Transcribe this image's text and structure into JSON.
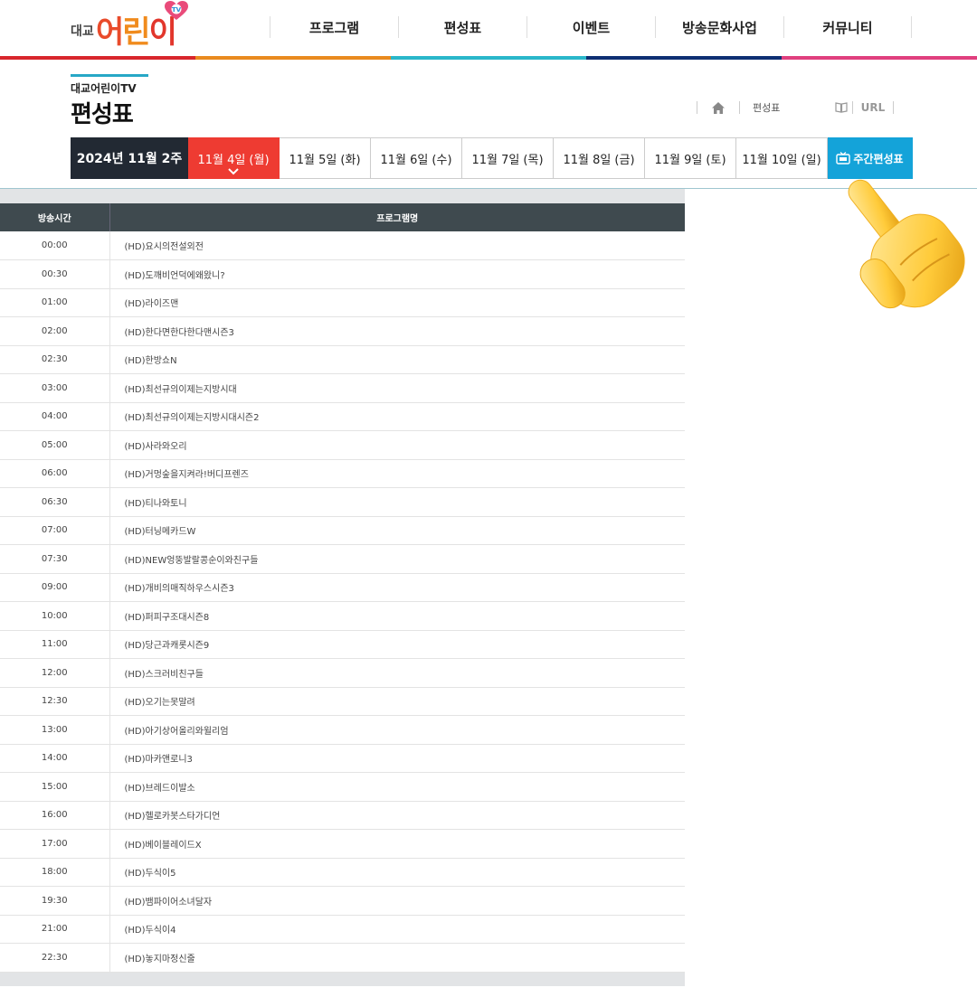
{
  "header": {
    "logo_small": "대교",
    "logo_main": "어린이",
    "nav": [
      "프로그램",
      "편성표",
      "이벤트",
      "방송문화사업",
      "커뮤니티"
    ]
  },
  "colors": [
    "#d8262c",
    "#e98a1f",
    "#2ab7ca",
    "#0e2f73",
    "#e0407e"
  ],
  "title": {
    "sub": "대교어린이TV",
    "main": "편성표"
  },
  "breadcrumb": {
    "page": "편성표",
    "url_label": "URL"
  },
  "tabs": {
    "week": "2024년 11월 2주",
    "days": [
      "11월 4일 (월)",
      "11월 5일 (화)",
      "11월 6일 (수)",
      "11월 7일 (목)",
      "11월 8일 (금)",
      "11월 9일 (토)",
      "11월 10일 (일)"
    ],
    "active_index": 0,
    "weekly": "주간편성표"
  },
  "table": {
    "headers": [
      "방송시간",
      "프로그램명"
    ],
    "rows": [
      [
        "00:00",
        "(HD)요시의전설외전"
      ],
      [
        "00:30",
        "(HD)도깨비언덕에왜왔니?"
      ],
      [
        "01:00",
        "(HD)라이즈맨"
      ],
      [
        "02:00",
        "(HD)한다면한다한다맨시즌3"
      ],
      [
        "02:30",
        "(HD)한방쇼N"
      ],
      [
        "03:00",
        "(HD)최선규의이제는지방시대"
      ],
      [
        "04:00",
        "(HD)최선규의이제는지방시대시즌2"
      ],
      [
        "05:00",
        "(HD)사라와오리"
      ],
      [
        "06:00",
        "(HD)거멍숲을지켜라!버디프렌즈"
      ],
      [
        "06:30",
        "(HD)티나와토니"
      ],
      [
        "07:00",
        "(HD)터닝메카드W"
      ],
      [
        "07:30",
        "(HD)NEW엉뚱발랄콩순이와친구들"
      ],
      [
        "09:00",
        "(HD)개비의매직하우스시즌3"
      ],
      [
        "10:00",
        "(HD)퍼피구조대시즌8"
      ],
      [
        "11:00",
        "(HD)당근과캐롯시즌9"
      ],
      [
        "12:00",
        "(HD)스크러비친구들"
      ],
      [
        "12:30",
        "(HD)오기는못말려"
      ],
      [
        "13:00",
        "(HD)아기상어올리와윌리엄"
      ],
      [
        "14:00",
        "(HD)마카앤로니3"
      ],
      [
        "15:00",
        "(HD)브레드이발소"
      ],
      [
        "16:00",
        "(HD)헬로카봇스타가디언"
      ],
      [
        "17:00",
        "(HD)베이블레이드X"
      ],
      [
        "18:00",
        "(HD)두식이5"
      ],
      [
        "19:30",
        "(HD)뱀파이어소녀달자"
      ],
      [
        "21:00",
        "(HD)두식이4"
      ],
      [
        "22:30",
        "(HD)놓지마정신줄"
      ]
    ]
  }
}
